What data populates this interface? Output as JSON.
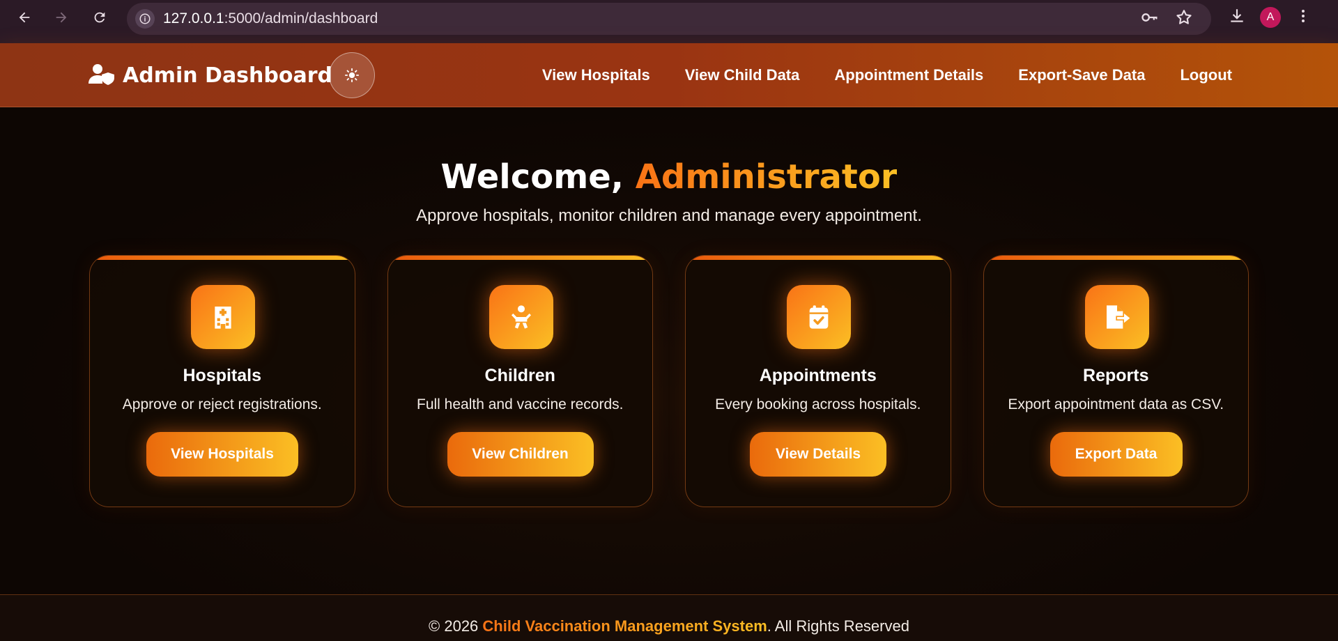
{
  "browser": {
    "url_host": "127.0.0.1",
    "url_rest": ":5000/admin/dashboard",
    "avatar_letter": "A"
  },
  "header": {
    "brand_title": "Admin Dashboard",
    "nav": [
      {
        "label": "View Hospitals"
      },
      {
        "label": "View Child Data"
      },
      {
        "label": "Appointment Details"
      },
      {
        "label": "Export-Save Data"
      },
      {
        "label": "Logout"
      }
    ]
  },
  "hero": {
    "welcome_prefix": "Welcome, ",
    "welcome_name": "Administrator",
    "subtitle": "Approve hospitals, monitor children and manage every appointment."
  },
  "cards": [
    {
      "title": "Hospitals",
      "desc": "Approve or reject registrations.",
      "button": "View Hospitals",
      "icon": "hospital-icon"
    },
    {
      "title": "Children",
      "desc": "Full health and vaccine records.",
      "button": "View Children",
      "icon": "baby-icon"
    },
    {
      "title": "Appointments",
      "desc": "Every booking across hospitals.",
      "button": "View Details",
      "icon": "calendar-check-icon"
    },
    {
      "title": "Reports",
      "desc": "Export appointment data as CSV.",
      "button": "Export Data",
      "icon": "file-export-icon"
    }
  ],
  "footer": {
    "prefix": "© 2026 ",
    "brand": "Child Vaccination Management System",
    "suffix": ". All Rights Reserved"
  },
  "colors": {
    "accent": "#f97316",
    "accent_light": "#fbbf24",
    "header": "#9a3412",
    "background": "#0d0603"
  }
}
